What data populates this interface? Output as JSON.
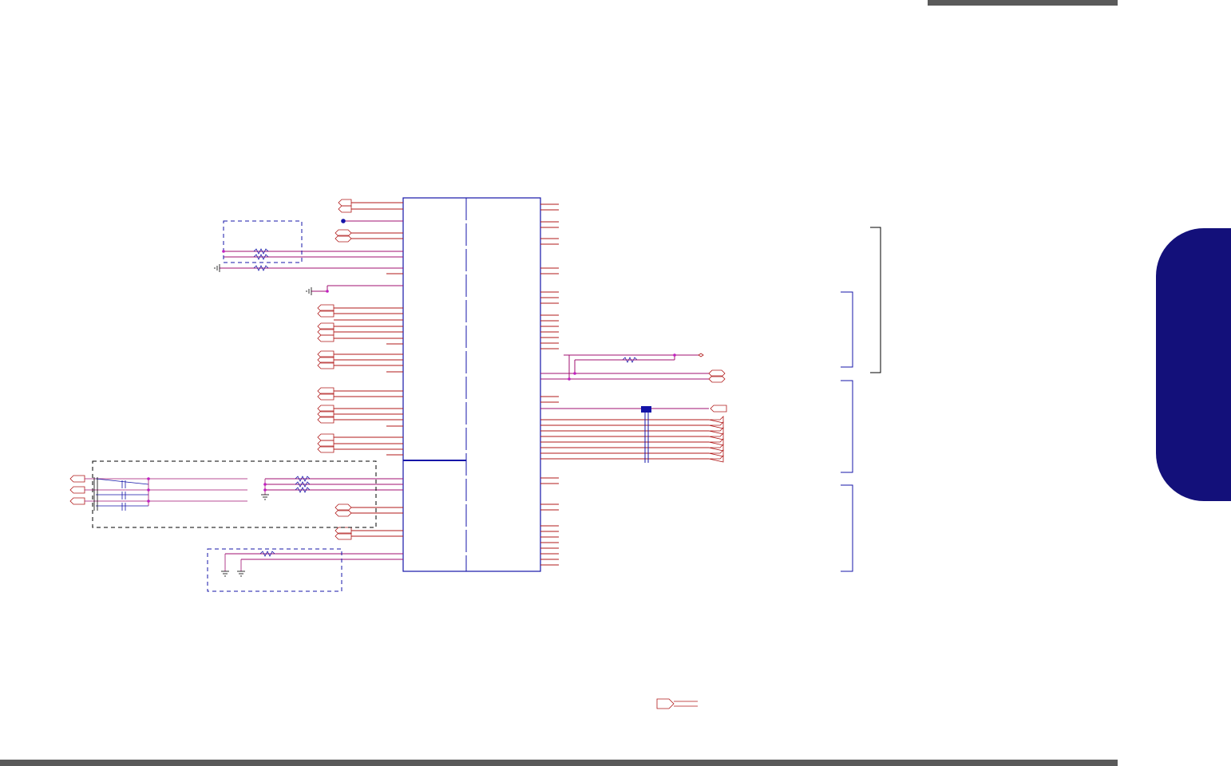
{
  "page": {
    "top_bar_color": "#5a5a5a",
    "bottom_bar_color": "#5a5a5a",
    "side_tab_color": "#13107a"
  },
  "schematic": {
    "wire_color": "#b01818",
    "net_color": "#a01070",
    "outline_color": "#1414a8",
    "junction_color": "#c020c0",
    "labels": []
  }
}
